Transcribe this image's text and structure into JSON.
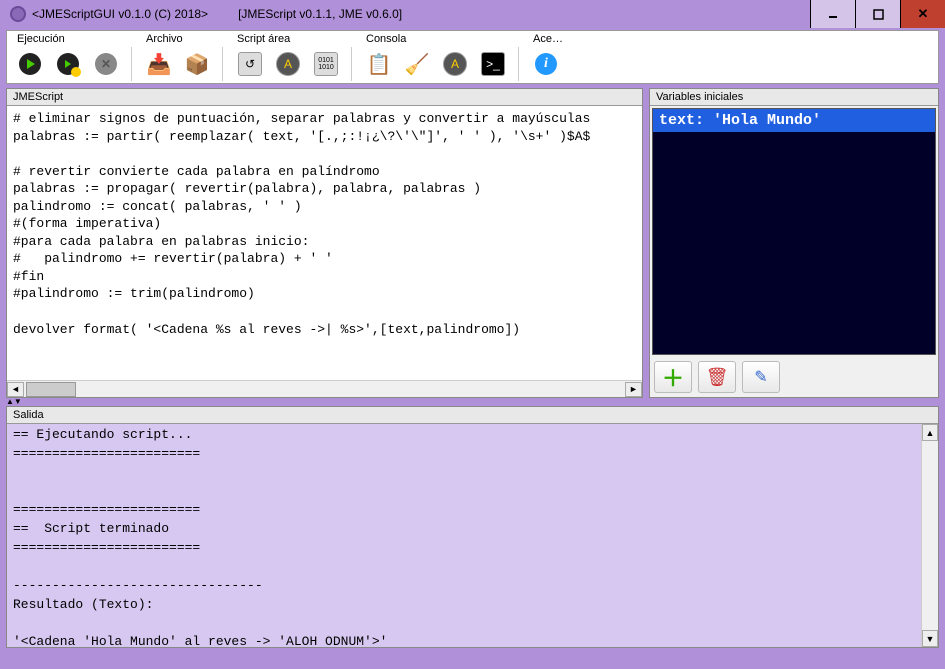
{
  "titlebar": {
    "app": "<JMEScriptGUI v0.1.0  (C) 2018>",
    "sub": "[JMEScript v0.1.1, JME v0.6.0]"
  },
  "toolbar": {
    "groups": {
      "ejecucion": "Ejecución",
      "archivo": "Archivo",
      "script": "Script área",
      "consola": "Consola",
      "acerca": "Ace…"
    }
  },
  "editor": {
    "title": "JMEScript",
    "code": "# eliminar signos de puntuación, separar palabras y convertir a mayúsculas\npalabras := partir( reemplazar( text, '[.,;:!¡¿\\?\\'\\\"]', ' ' ), '\\s+' )$A$\n\n# revertir convierte cada palabra en palíndromo\npalabras := propagar( revertir(palabra), palabra, palabras )\npalindromo := concat( palabras, ' ' )\n#(forma imperativa)\n#para cada palabra en palabras inicio:\n#   palindromo += revertir(palabra) + ' '\n#fin\n#palindromo := trim(palindromo)\n\ndevolver format( '<Cadena %s al reves ->| %s>',[text,palindromo])"
  },
  "vars": {
    "title": "Variables iniciales",
    "line": "text:  'Hola Mundo'"
  },
  "output": {
    "title": "Salida",
    "text": "== Ejecutando script...\n========================\n\n\n========================\n==  Script terminado\n========================\n\n--------------------------------\nResultado (Texto):\n\n'<Cadena 'Hola Mundo' al reves -> 'ALOH ODNUM'>'\n--------------------------------"
  }
}
